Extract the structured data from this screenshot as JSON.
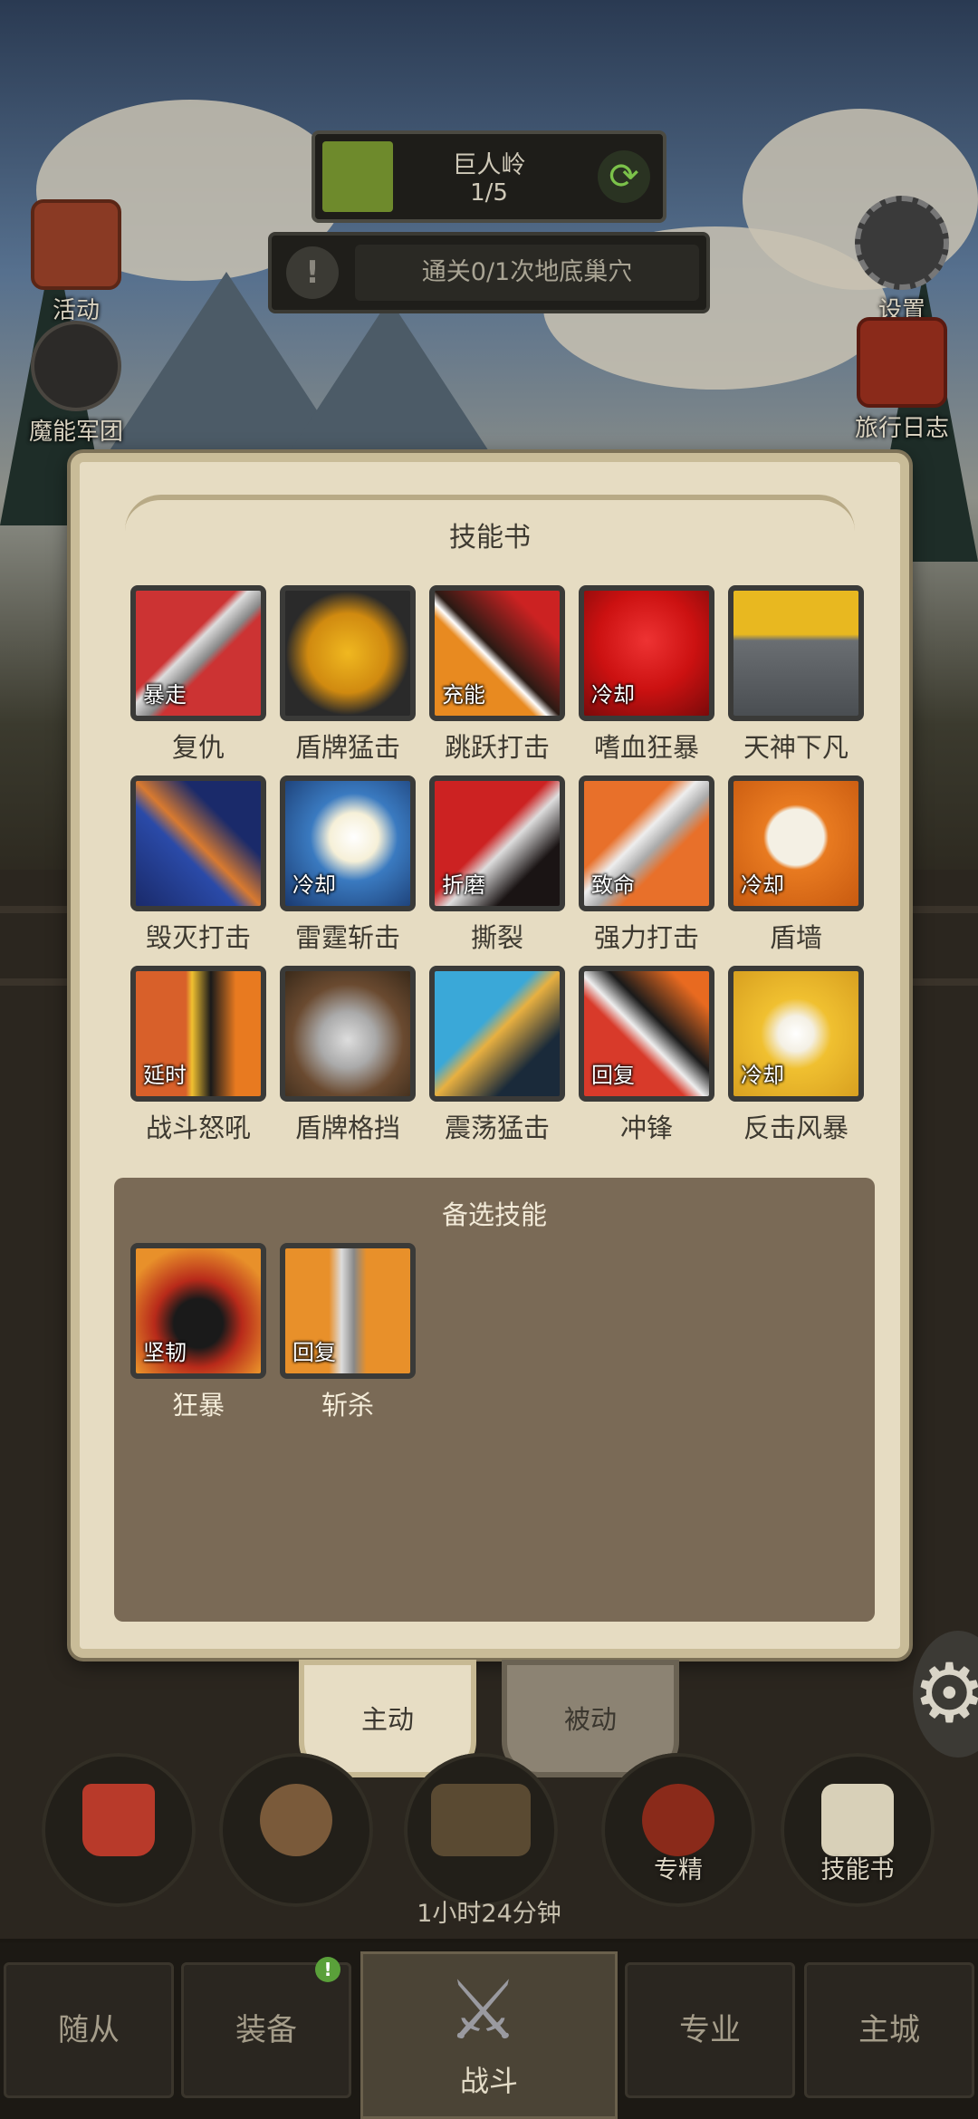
{
  "hud": {
    "stage_title": "巨人岭",
    "stage_count": "1/5",
    "refresh_icon": "⟳",
    "quest_icon": "!",
    "quest_text": "通关0/1次地底巢穴"
  },
  "side_left": [
    {
      "label": "活动"
    },
    {
      "label": "魔能军团"
    }
  ],
  "side_right": [
    {
      "label": "设置"
    },
    {
      "label": "旅行日志"
    }
  ],
  "panel": {
    "title": "技能书",
    "skills": [
      {
        "name": "复仇",
        "badge": "暴走"
      },
      {
        "name": "盾牌猛击",
        "badge": ""
      },
      {
        "name": "跳跃打击",
        "badge": "充能"
      },
      {
        "name": "嗜血狂暴",
        "badge": "冷却"
      },
      {
        "name": "天神下凡",
        "badge": ""
      },
      {
        "name": "毁灭打击",
        "badge": ""
      },
      {
        "name": "雷霆斩击",
        "badge": "冷却"
      },
      {
        "name": "撕裂",
        "badge": "折磨"
      },
      {
        "name": "强力打击",
        "badge": "致命"
      },
      {
        "name": "盾墙",
        "badge": "冷却"
      },
      {
        "name": "战斗怒吼",
        "badge": "延时"
      },
      {
        "name": "盾牌格挡",
        "badge": ""
      },
      {
        "name": "震荡猛击",
        "badge": ""
      },
      {
        "name": "冲锋",
        "badge": "回复"
      },
      {
        "name": "反击风暴",
        "badge": "冷却"
      }
    ],
    "alt_title": "备选技能",
    "alt_skills": [
      {
        "name": "狂暴",
        "badge": "坚韧"
      },
      {
        "name": "斩杀",
        "badge": "回复"
      }
    ]
  },
  "tabs": {
    "active": "主动",
    "passive": "被动"
  },
  "actions": {
    "specialize": "专精",
    "skillbook": "技能书",
    "timer": "1小时24分钟"
  },
  "nav": {
    "followers": "随从",
    "equipment": "装备",
    "battle": "战斗",
    "profession": "专业",
    "city": "主城",
    "equipment_notif": "!"
  },
  "colors": {
    "panel_bg": "#e6dcc2",
    "alt_bg": "#7a6a56",
    "progress": "#6e8a2c"
  }
}
